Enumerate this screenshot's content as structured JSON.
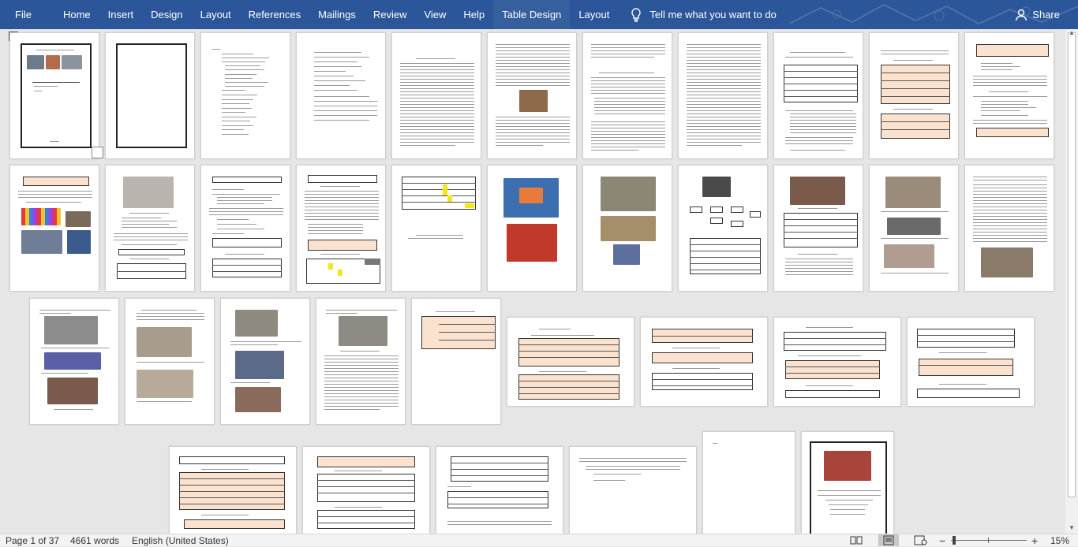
{
  "ribbon": {
    "tabs": [
      "File",
      "Home",
      "Insert",
      "Design",
      "Layout",
      "References",
      "Mailings",
      "Review",
      "View",
      "Help",
      "Table Design",
      "Layout"
    ],
    "tell_me": "Tell me what you want to do",
    "share": "Share"
  },
  "status": {
    "page": "Page 1 of 37",
    "words": "4661 words",
    "language": "English (United States)",
    "zoom": "15%",
    "zoom_minus": "−",
    "zoom_plus": "+"
  },
  "icons": {
    "tell_me": "lightbulb-icon",
    "share": "person-icon",
    "table_move": "move-handle-icon",
    "read_mode": "read-mode-icon",
    "print_layout": "print-layout-icon",
    "web_layout": "web-layout-icon"
  },
  "colors": {
    "ribbon": "#2b579a",
    "table_shading": "#fbe2cf",
    "highlight": "#f5e51c"
  }
}
